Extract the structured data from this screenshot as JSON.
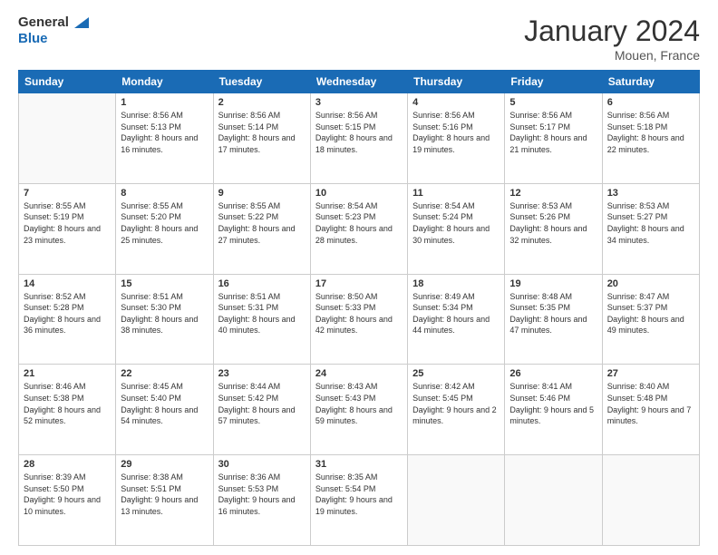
{
  "logo": {
    "text_general": "General",
    "text_blue": "Blue"
  },
  "header": {
    "title": "January 2024",
    "subtitle": "Mouen, France"
  },
  "columns": [
    "Sunday",
    "Monday",
    "Tuesday",
    "Wednesday",
    "Thursday",
    "Friday",
    "Saturday"
  ],
  "weeks": [
    [
      {
        "day": "",
        "sunrise": "",
        "sunset": "",
        "daylight": ""
      },
      {
        "day": "1",
        "sunrise": "8:56 AM",
        "sunset": "5:13 PM",
        "daylight": "8 hours and 16 minutes."
      },
      {
        "day": "2",
        "sunrise": "8:56 AM",
        "sunset": "5:14 PM",
        "daylight": "8 hours and 17 minutes."
      },
      {
        "day": "3",
        "sunrise": "8:56 AM",
        "sunset": "5:15 PM",
        "daylight": "8 hours and 18 minutes."
      },
      {
        "day": "4",
        "sunrise": "8:56 AM",
        "sunset": "5:16 PM",
        "daylight": "8 hours and 19 minutes."
      },
      {
        "day": "5",
        "sunrise": "8:56 AM",
        "sunset": "5:17 PM",
        "daylight": "8 hours and 21 minutes."
      },
      {
        "day": "6",
        "sunrise": "8:56 AM",
        "sunset": "5:18 PM",
        "daylight": "8 hours and 22 minutes."
      }
    ],
    [
      {
        "day": "7",
        "sunrise": "8:55 AM",
        "sunset": "5:19 PM",
        "daylight": "8 hours and 23 minutes."
      },
      {
        "day": "8",
        "sunrise": "8:55 AM",
        "sunset": "5:20 PM",
        "daylight": "8 hours and 25 minutes."
      },
      {
        "day": "9",
        "sunrise": "8:55 AM",
        "sunset": "5:22 PM",
        "daylight": "8 hours and 27 minutes."
      },
      {
        "day": "10",
        "sunrise": "8:54 AM",
        "sunset": "5:23 PM",
        "daylight": "8 hours and 28 minutes."
      },
      {
        "day": "11",
        "sunrise": "8:54 AM",
        "sunset": "5:24 PM",
        "daylight": "8 hours and 30 minutes."
      },
      {
        "day": "12",
        "sunrise": "8:53 AM",
        "sunset": "5:26 PM",
        "daylight": "8 hours and 32 minutes."
      },
      {
        "day": "13",
        "sunrise": "8:53 AM",
        "sunset": "5:27 PM",
        "daylight": "8 hours and 34 minutes."
      }
    ],
    [
      {
        "day": "14",
        "sunrise": "8:52 AM",
        "sunset": "5:28 PM",
        "daylight": "8 hours and 36 minutes."
      },
      {
        "day": "15",
        "sunrise": "8:51 AM",
        "sunset": "5:30 PM",
        "daylight": "8 hours and 38 minutes."
      },
      {
        "day": "16",
        "sunrise": "8:51 AM",
        "sunset": "5:31 PM",
        "daylight": "8 hours and 40 minutes."
      },
      {
        "day": "17",
        "sunrise": "8:50 AM",
        "sunset": "5:33 PM",
        "daylight": "8 hours and 42 minutes."
      },
      {
        "day": "18",
        "sunrise": "8:49 AM",
        "sunset": "5:34 PM",
        "daylight": "8 hours and 44 minutes."
      },
      {
        "day": "19",
        "sunrise": "8:48 AM",
        "sunset": "5:35 PM",
        "daylight": "8 hours and 47 minutes."
      },
      {
        "day": "20",
        "sunrise": "8:47 AM",
        "sunset": "5:37 PM",
        "daylight": "8 hours and 49 minutes."
      }
    ],
    [
      {
        "day": "21",
        "sunrise": "8:46 AM",
        "sunset": "5:38 PM",
        "daylight": "8 hours and 52 minutes."
      },
      {
        "day": "22",
        "sunrise": "8:45 AM",
        "sunset": "5:40 PM",
        "daylight": "8 hours and 54 minutes."
      },
      {
        "day": "23",
        "sunrise": "8:44 AM",
        "sunset": "5:42 PM",
        "daylight": "8 hours and 57 minutes."
      },
      {
        "day": "24",
        "sunrise": "8:43 AM",
        "sunset": "5:43 PM",
        "daylight": "8 hours and 59 minutes."
      },
      {
        "day": "25",
        "sunrise": "8:42 AM",
        "sunset": "5:45 PM",
        "daylight": "9 hours and 2 minutes."
      },
      {
        "day": "26",
        "sunrise": "8:41 AM",
        "sunset": "5:46 PM",
        "daylight": "9 hours and 5 minutes."
      },
      {
        "day": "27",
        "sunrise": "8:40 AM",
        "sunset": "5:48 PM",
        "daylight": "9 hours and 7 minutes."
      }
    ],
    [
      {
        "day": "28",
        "sunrise": "8:39 AM",
        "sunset": "5:50 PM",
        "daylight": "9 hours and 10 minutes."
      },
      {
        "day": "29",
        "sunrise": "8:38 AM",
        "sunset": "5:51 PM",
        "daylight": "9 hours and 13 minutes."
      },
      {
        "day": "30",
        "sunrise": "8:36 AM",
        "sunset": "5:53 PM",
        "daylight": "9 hours and 16 minutes."
      },
      {
        "day": "31",
        "sunrise": "8:35 AM",
        "sunset": "5:54 PM",
        "daylight": "9 hours and 19 minutes."
      },
      {
        "day": "",
        "sunrise": "",
        "sunset": "",
        "daylight": ""
      },
      {
        "day": "",
        "sunrise": "",
        "sunset": "",
        "daylight": ""
      },
      {
        "day": "",
        "sunrise": "",
        "sunset": "",
        "daylight": ""
      }
    ]
  ],
  "labels": {
    "sunrise_prefix": "Sunrise: ",
    "sunset_prefix": "Sunset: ",
    "daylight_prefix": "Daylight: "
  }
}
